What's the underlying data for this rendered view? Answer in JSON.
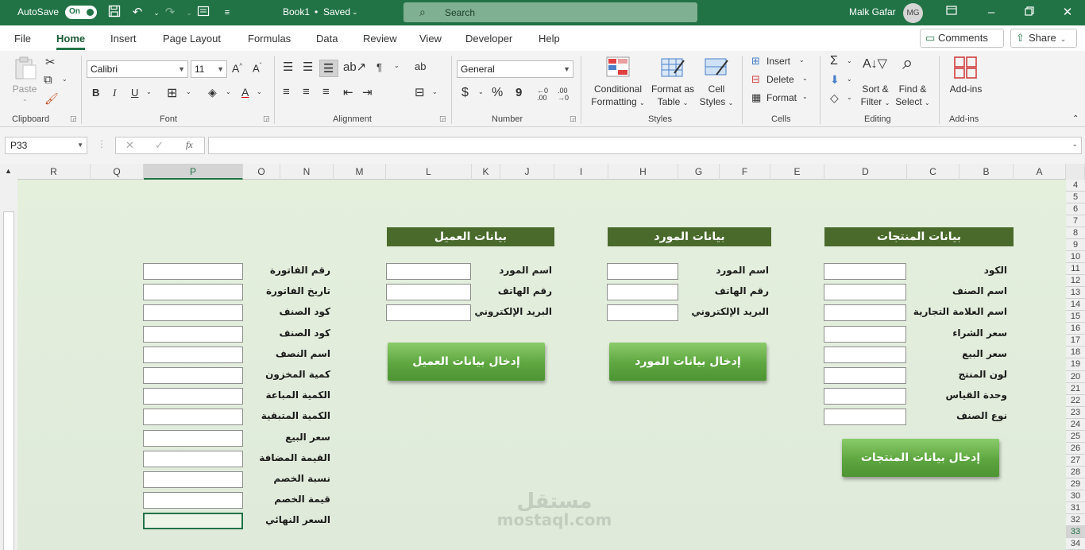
{
  "titlebar": {
    "autosave_label": "AutoSave",
    "autosave_state": "On",
    "doc_title": "Book1",
    "doc_status": "Saved",
    "search_placeholder": "Search",
    "user_name": "Malk Gafar",
    "user_initials": "MG"
  },
  "menu": {
    "tabs": [
      "File",
      "Home",
      "Insert",
      "Page Layout",
      "Formulas",
      "Data",
      "Review",
      "View",
      "Developer",
      "Help"
    ],
    "active_tab": "Home",
    "comments_label": "Comments",
    "share_label": "Share"
  },
  "ribbon": {
    "clipboard": {
      "paste_label": "Paste",
      "group_label": "Clipboard"
    },
    "font": {
      "font_name": "Calibri",
      "font_size": "11",
      "bold": "B",
      "italic": "I",
      "underline": "U",
      "group_label": "Font"
    },
    "alignment": {
      "group_label": "Alignment"
    },
    "number": {
      "format": "General",
      "group_label": "Number",
      "currency": "$",
      "percent": "%",
      "comma": "9"
    },
    "styles": {
      "conditional_l1": "Conditional",
      "conditional_l2": "Formatting",
      "table_l1": "Format as",
      "table_l2": "Table",
      "cell_l1": "Cell",
      "cell_l2": "Styles",
      "group_label": "Styles"
    },
    "cells": {
      "insert": "Insert",
      "delete": "Delete",
      "format": "Format",
      "group_label": "Cells"
    },
    "editing": {
      "sort_l1": "Sort &",
      "sort_l2": "Filter",
      "find_l1": "Find &",
      "find_l2": "Select",
      "group_label": "Editing"
    },
    "addins": {
      "label": "Add-ins",
      "group_label": "Add-ins"
    }
  },
  "formula_bar": {
    "name_box": "P33",
    "fx": "fx",
    "value": ""
  },
  "grid": {
    "columns": [
      "R",
      "Q",
      "P",
      "O",
      "N",
      "M",
      "L",
      "K",
      "J",
      "I",
      "H",
      "G",
      "F",
      "E",
      "D",
      "C",
      "B",
      "A"
    ],
    "selected_column": "P",
    "rows": [
      "4",
      "5",
      "6",
      "7",
      "8",
      "9",
      "10",
      "11",
      "12",
      "13",
      "14",
      "15",
      "16",
      "17",
      "18",
      "19",
      "20",
      "21",
      "22",
      "23",
      "24",
      "25",
      "26",
      "27",
      "28",
      "29",
      "30",
      "31",
      "32",
      "33",
      "34"
    ],
    "selected_row": "33"
  },
  "sheet": {
    "products": {
      "title": "بيانات المنتجات",
      "fields": [
        "الكود",
        "اسم الصنف",
        "اسم العلامة التجارية",
        "سعر الشراء",
        "سعر البيع",
        "لون المنتج",
        "وحدة القياس",
        "نوع الصنف"
      ],
      "button": "إدخال بيانات المنتجات"
    },
    "supplier": {
      "title": "بيانات المورد",
      "fields": [
        "اسم المورد",
        "رقم الهاتف",
        "البريد الإلكتروني"
      ],
      "button": "إدخال بيانات المورد"
    },
    "customer": {
      "title": "بيانات العميل",
      "fields": [
        "اسم المورد",
        "رقم الهاتف",
        "البريد الإلكتروني"
      ],
      "button": "إدخال بيانات العميل"
    },
    "invoice": {
      "fields": [
        "رقم الفاتورة",
        "تاريخ الفاتورة",
        "كود الصنف",
        "كود الصنف",
        "اسم النصف",
        "كمية المخزون",
        "الكمية المباعة",
        "الكمية المتبقية",
        "سعر البيع",
        "القيمة المضافة",
        "نسبة الخصم",
        "قيمة الخصم",
        "السعر النهائي"
      ]
    },
    "watermark_line1": "مستقل",
    "watermark_line2": "mostaql.com"
  },
  "colors": {
    "excel_green": "#217346",
    "section_header": "#4a6a2c",
    "button_green": "#5ea640",
    "sheet_bg": "#e2eddb"
  }
}
